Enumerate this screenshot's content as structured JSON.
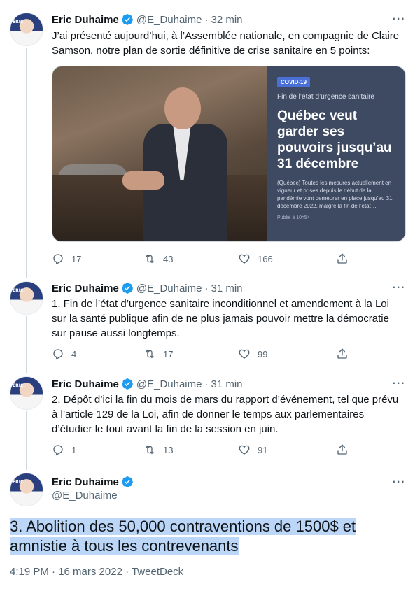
{
  "tweets": [
    {
      "name": "Eric Duhaime",
      "handle": "@E_Duhaime",
      "time": "32 min",
      "text": "J’ai présenté aujourd’hui, à l’Assemblée nationale, en compagnie de Claire Samson, notre plan de sortie définitive de crise sanitaire en 5 points:",
      "media_card": {
        "tag": "COVID-19",
        "kicker": "Fin de l’état d’urgence sanitaire",
        "title": "Québec veut garder ses pouvoirs jusqu’au 31 décembre",
        "body": "(Québec) Toutes les mesures actuellement en vigueur et prises depuis le début de la pandémie vont demeurer en place jusqu’au 31 décembre 2022, malgré la fin de l’état…",
        "published": "Publié à 10h54"
      },
      "replies": "17",
      "retweets": "43",
      "likes": "166"
    },
    {
      "name": "Eric Duhaime",
      "handle": "@E_Duhaime",
      "time": "31 min",
      "text": "1. Fin de l’état d’urgence sanitaire inconditionnel et amendement à la Loi sur la santé publique afin de ne plus jamais pouvoir mettre la démocratie sur pause aussi longtemps.",
      "replies": "4",
      "retweets": "17",
      "likes": "99"
    },
    {
      "name": "Eric Duhaime",
      "handle": "@E_Duhaime",
      "time": "31 min",
      "text": "2. Dépôt d’ici la fin du mois de mars du rapport d’événement, tel que prévu à l’article 129 de la Loi, afin de donner le temps aux parlementaires d’étudier le tout avant la fin de la session en juin.",
      "replies": "1",
      "retweets": "13",
      "likes": "91"
    }
  ],
  "main_tweet": {
    "name": "Eric Duhaime",
    "handle": "@E_Duhaime",
    "text_line1": "3. Abolition des 50,000 contraventions de 1500$ et",
    "text_line2": "amnistie à tous les contrevenants",
    "meta": "4:19 PM · 16 mars 2022 · TweetDeck"
  },
  "avatar_label": "ÉRIC",
  "more_label": "···",
  "separator": "·",
  "colors": {
    "verified": "#1d9bf0",
    "secondary": "#536471",
    "highlight": "#bcd6f7",
    "thread_line": "#cfd9de"
  }
}
